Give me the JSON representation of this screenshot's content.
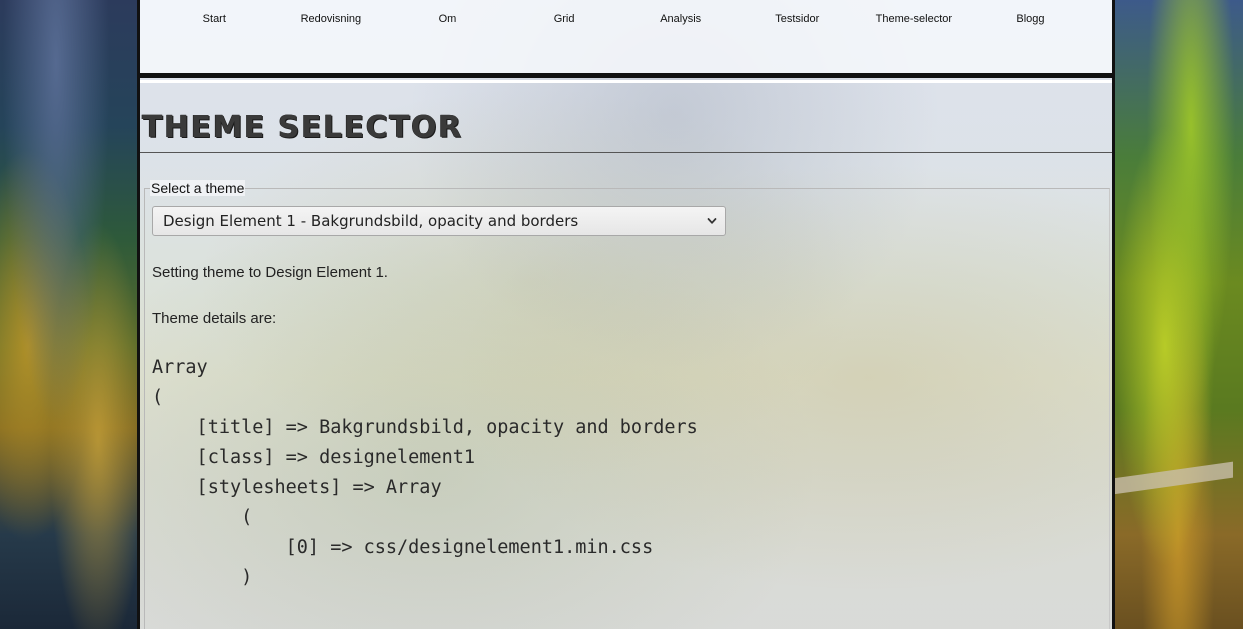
{
  "nav": {
    "items": [
      {
        "label": "Start"
      },
      {
        "label": "Redovisning"
      },
      {
        "label": "Om"
      },
      {
        "label": "Grid"
      },
      {
        "label": "Analysis"
      },
      {
        "label": "Testsidor"
      },
      {
        "label": "Theme-selector"
      },
      {
        "label": "Blogg"
      }
    ]
  },
  "page": {
    "title": "Theme selector"
  },
  "form": {
    "legend": "Select a theme",
    "select_value": "Design Element 1 - Bakgrundsbild, opacity and borders"
  },
  "messages": {
    "setting": "Setting theme to Design Element 1.",
    "details": "Theme details are:"
  },
  "array_dump": {
    "lines": [
      "Array",
      "(",
      "    [title] => Bakgrundsbild, opacity and borders",
      "    [class] => designelement1",
      "    [stylesheets] => Array",
      "        (",
      "            [0] => css/designelement1.min.css",
      "        )"
    ]
  },
  "icons": {
    "select_arrow": "chevron-down-icon"
  }
}
